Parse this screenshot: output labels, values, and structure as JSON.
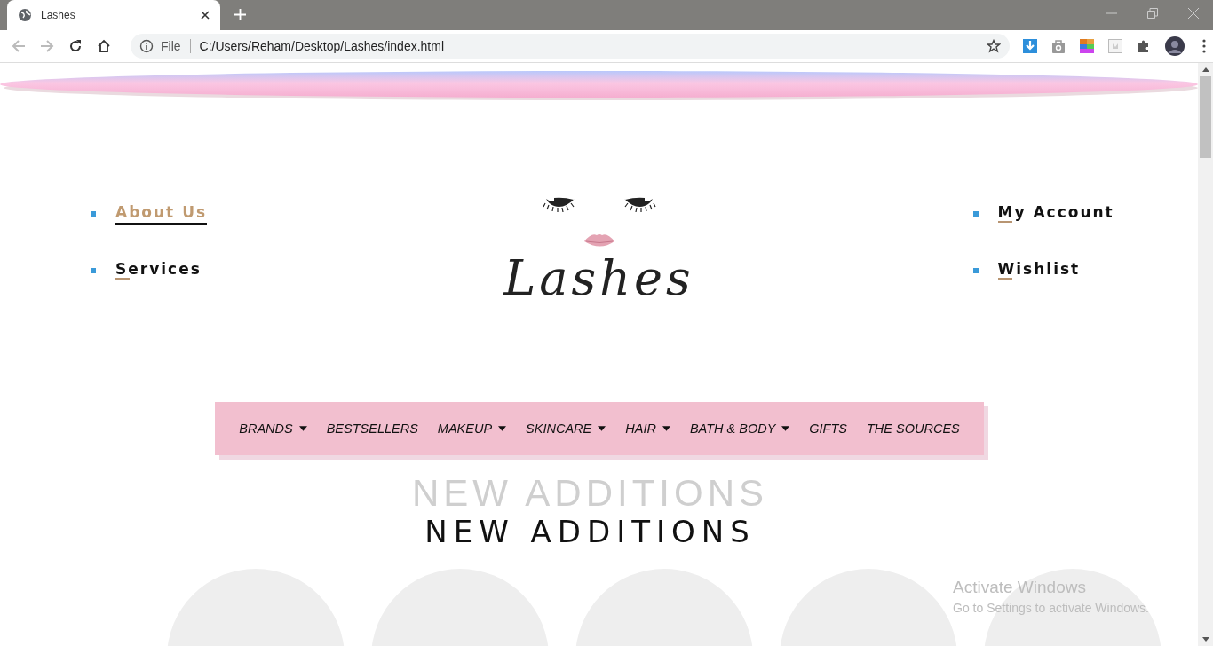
{
  "browser": {
    "tab_title": "Lashes",
    "address_label": "File",
    "url": "C:/Users/Reham/Desktop/Lashes/index.html"
  },
  "nav_left": [
    {
      "label": "About Us",
      "selected": true
    },
    {
      "label": "Services",
      "selected": false
    }
  ],
  "logo": {
    "text": "Lashes"
  },
  "nav_right": [
    {
      "label": "My Account",
      "selected": false
    },
    {
      "label": "Wishlist",
      "selected": false
    }
  ],
  "menu": [
    {
      "label": "BRANDS",
      "dropdown": true
    },
    {
      "label": "BESTSELLERS",
      "dropdown": false
    },
    {
      "label": "MAKEUP",
      "dropdown": true
    },
    {
      "label": "SKINCARE",
      "dropdown": true
    },
    {
      "label": "HAIR",
      "dropdown": true
    },
    {
      "label": "BATH & BODY",
      "dropdown": true
    },
    {
      "label": "GIFTS",
      "dropdown": false
    },
    {
      "label": "THE SOURCES",
      "dropdown": false
    }
  ],
  "section": {
    "ghost_title": "NEW ADDITIONS",
    "title": "NEW ADDITIONS"
  },
  "products": [
    {
      "kind": "circle"
    },
    {
      "kind": "circle"
    },
    {
      "kind": "circle"
    },
    {
      "kind": "circle"
    },
    {
      "kind": "circle"
    }
  ],
  "os_notice": {
    "title": "Activate Windows",
    "subtitle": "Go to Settings to activate Windows."
  }
}
